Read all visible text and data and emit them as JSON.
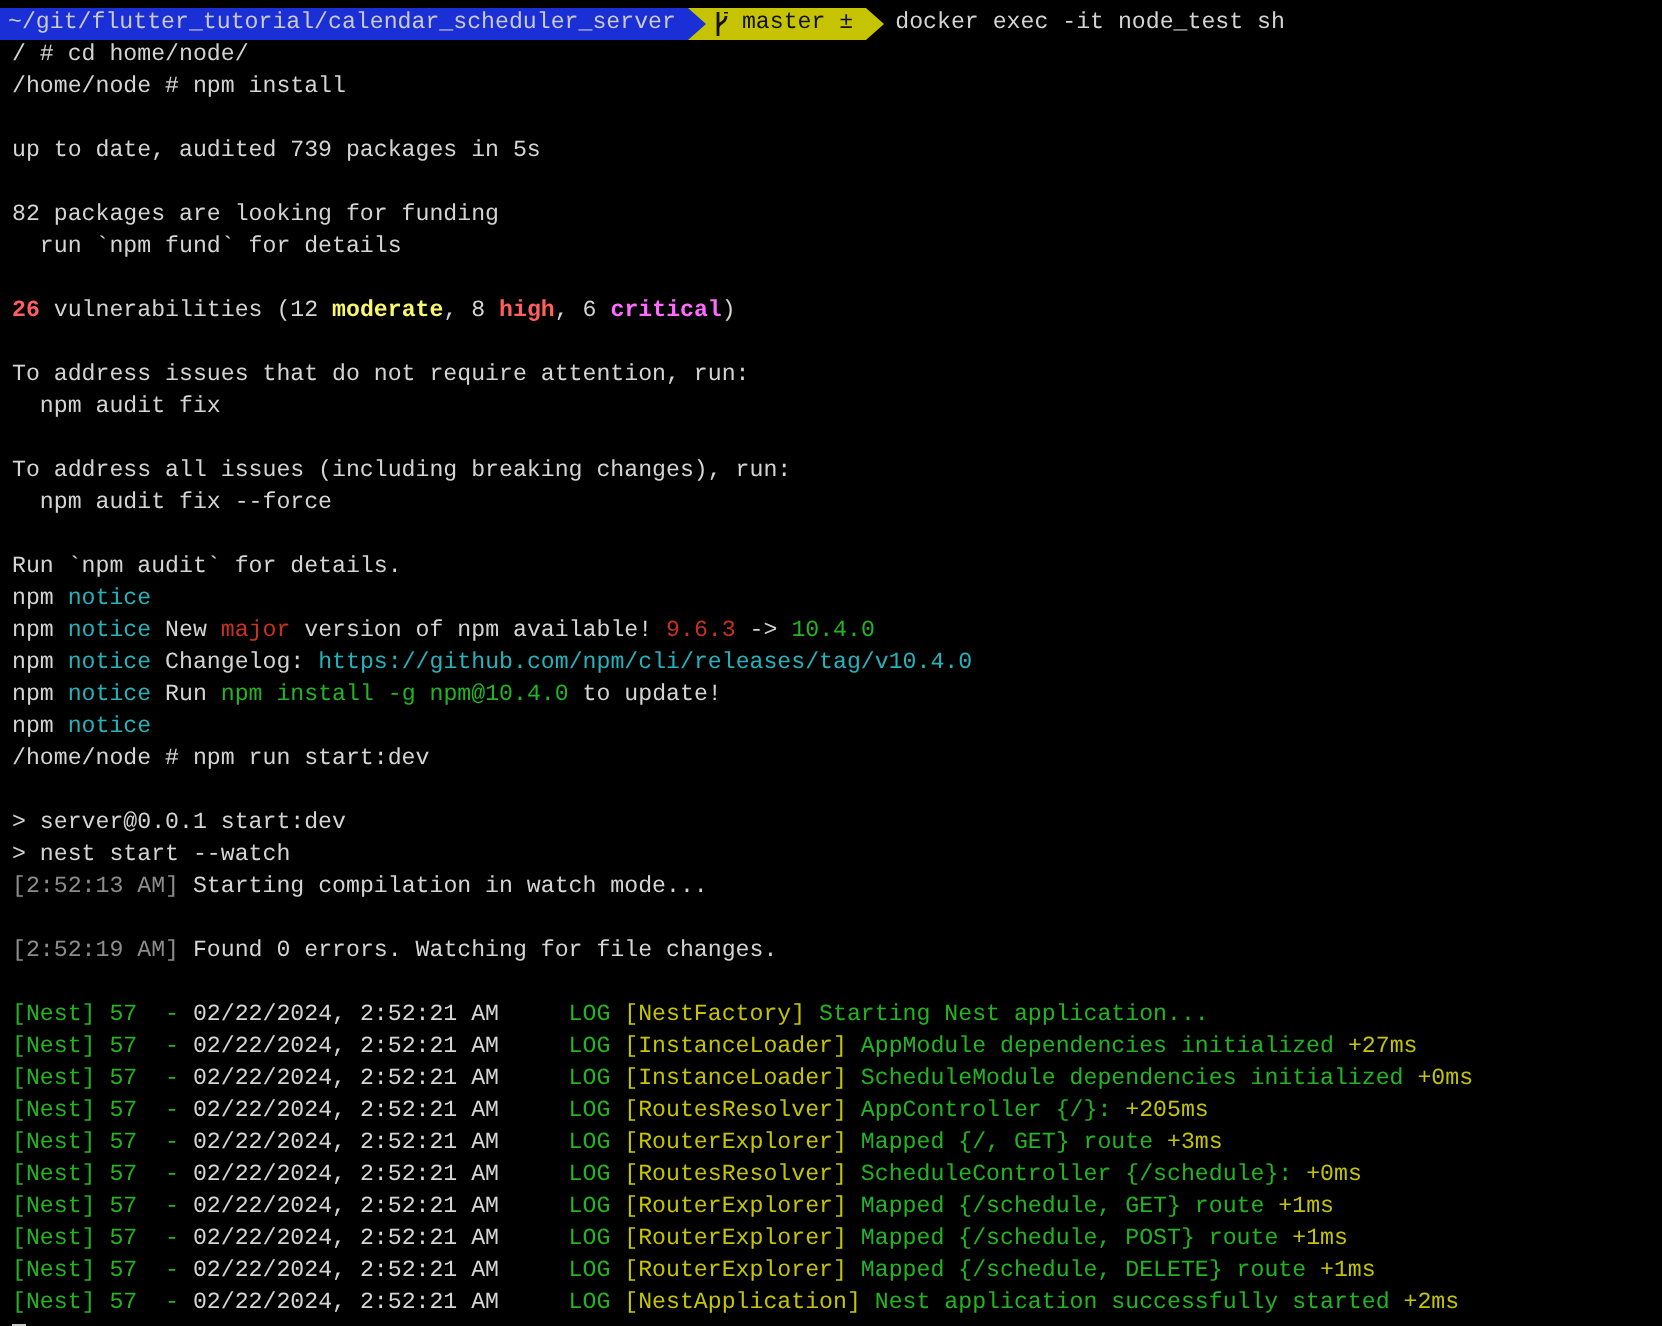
{
  "prompt": {
    "path": "~/git/flutter_tutorial/calendar_scheduler_server",
    "branch": "master ±",
    "command": "docker exec -it node_test sh"
  },
  "lines": [
    {
      "kind": "text",
      "segments": [
        {
          "text": "/ # cd home/node/",
          "kind": "plain"
        }
      ]
    },
    {
      "kind": "text",
      "segments": [
        {
          "text": "/home/node # npm install",
          "kind": "plain"
        }
      ]
    },
    {
      "kind": "blank"
    },
    {
      "kind": "text",
      "segments": [
        {
          "text": "up to date, audited 739 packages in 5s",
          "kind": "plain"
        }
      ]
    },
    {
      "kind": "blank"
    },
    {
      "kind": "text",
      "segments": [
        {
          "text": "82 packages are looking for funding",
          "kind": "plain"
        }
      ]
    },
    {
      "kind": "text",
      "segments": [
        {
          "text": "  run `npm fund` for details",
          "kind": "plain"
        }
      ]
    },
    {
      "kind": "blank"
    },
    {
      "kind": "text",
      "segments": [
        {
          "text": "26",
          "kind": "bold-red"
        },
        {
          "text": " vulnerabilities (12 ",
          "kind": "plain"
        },
        {
          "text": "moderate",
          "kind": "bold-yellow"
        },
        {
          "text": ", 8 ",
          "kind": "plain"
        },
        {
          "text": "high",
          "kind": "bold-red"
        },
        {
          "text": ", 6 ",
          "kind": "plain"
        },
        {
          "text": "critical",
          "kind": "bold-magenta"
        },
        {
          "text": ")",
          "kind": "plain"
        }
      ]
    },
    {
      "kind": "blank"
    },
    {
      "kind": "text",
      "segments": [
        {
          "text": "To address issues that do not require attention, run:",
          "kind": "plain"
        }
      ]
    },
    {
      "kind": "text",
      "segments": [
        {
          "text": "  npm audit fix",
          "kind": "plain"
        }
      ]
    },
    {
      "kind": "blank"
    },
    {
      "kind": "text",
      "segments": [
        {
          "text": "To address all issues (including breaking changes), run:",
          "kind": "plain"
        }
      ]
    },
    {
      "kind": "text",
      "segments": [
        {
          "text": "  npm audit fix --force",
          "kind": "plain"
        }
      ]
    },
    {
      "kind": "blank"
    },
    {
      "kind": "text",
      "segments": [
        {
          "text": "Run `npm audit` for details.",
          "kind": "plain"
        }
      ]
    },
    {
      "kind": "text",
      "segments": [
        {
          "text": "npm ",
          "kind": "plain"
        },
        {
          "text": "notice",
          "kind": "cyan"
        }
      ]
    },
    {
      "kind": "text",
      "segments": [
        {
          "text": "npm ",
          "kind": "plain"
        },
        {
          "text": "notice",
          "kind": "cyan"
        },
        {
          "text": " New ",
          "kind": "plain"
        },
        {
          "text": "major",
          "kind": "red"
        },
        {
          "text": " version of npm available! ",
          "kind": "plain"
        },
        {
          "text": "9.6.3",
          "kind": "red"
        },
        {
          "text": " -> ",
          "kind": "plain"
        },
        {
          "text": "10.4.0",
          "kind": "green"
        }
      ]
    },
    {
      "kind": "text",
      "segments": [
        {
          "text": "npm ",
          "kind": "plain"
        },
        {
          "text": "notice",
          "kind": "cyan"
        },
        {
          "text": " Changelog: ",
          "kind": "plain"
        },
        {
          "text": "https://github.com/npm/cli/releases/tag/v10.4.0",
          "kind": "cyan"
        }
      ]
    },
    {
      "kind": "text",
      "segments": [
        {
          "text": "npm ",
          "kind": "plain"
        },
        {
          "text": "notice",
          "kind": "cyan"
        },
        {
          "text": " Run ",
          "kind": "plain"
        },
        {
          "text": "npm install -g npm@10.4.0",
          "kind": "green"
        },
        {
          "text": " to update!",
          "kind": "plain"
        }
      ]
    },
    {
      "kind": "text",
      "segments": [
        {
          "text": "npm ",
          "kind": "plain"
        },
        {
          "text": "notice",
          "kind": "cyan"
        }
      ]
    },
    {
      "kind": "text",
      "segments": [
        {
          "text": "/home/node # npm run start:dev",
          "kind": "plain"
        }
      ]
    },
    {
      "kind": "blank"
    },
    {
      "kind": "text",
      "segments": [
        {
          "text": "> server@0.0.1 start:dev",
          "kind": "plain"
        }
      ]
    },
    {
      "kind": "text",
      "segments": [
        {
          "text": "> nest start --watch",
          "kind": "plain"
        }
      ]
    },
    {
      "kind": "text",
      "segments": [
        {
          "text": "[2:52:13 AM]",
          "kind": "gray"
        },
        {
          "text": " Starting compilation in watch mode...",
          "kind": "plain"
        }
      ]
    },
    {
      "kind": "blank"
    },
    {
      "kind": "text",
      "segments": [
        {
          "text": "[2:52:19 AM]",
          "kind": "gray"
        },
        {
          "text": " Found 0 errors. Watching for file changes.",
          "kind": "plain"
        }
      ]
    },
    {
      "kind": "blank"
    },
    {
      "kind": "text",
      "segments": [
        {
          "text": "[Nest] 57  - ",
          "kind": "green"
        },
        {
          "text": "02/22/2024, 2:52:21 AM",
          "kind": "plain"
        },
        {
          "text": "     LOG ",
          "kind": "green"
        },
        {
          "text": "[NestFactory]",
          "kind": "yellow"
        },
        {
          "text": " Starting Nest application...",
          "kind": "green"
        }
      ]
    },
    {
      "kind": "text",
      "segments": [
        {
          "text": "[Nest] 57  - ",
          "kind": "green"
        },
        {
          "text": "02/22/2024, 2:52:21 AM",
          "kind": "plain"
        },
        {
          "text": "     LOG ",
          "kind": "green"
        },
        {
          "text": "[InstanceLoader]",
          "kind": "yellow"
        },
        {
          "text": " AppModule dependencies initialized",
          "kind": "green"
        },
        {
          "text": " +27ms",
          "kind": "yellow"
        }
      ]
    },
    {
      "kind": "text",
      "segments": [
        {
          "text": "[Nest] 57  - ",
          "kind": "green"
        },
        {
          "text": "02/22/2024, 2:52:21 AM",
          "kind": "plain"
        },
        {
          "text": "     LOG ",
          "kind": "green"
        },
        {
          "text": "[InstanceLoader]",
          "kind": "yellow"
        },
        {
          "text": " ScheduleModule dependencies initialized",
          "kind": "green"
        },
        {
          "text": " +0ms",
          "kind": "yellow"
        }
      ]
    },
    {
      "kind": "text",
      "segments": [
        {
          "text": "[Nest] 57  - ",
          "kind": "green"
        },
        {
          "text": "02/22/2024, 2:52:21 AM",
          "kind": "plain"
        },
        {
          "text": "     LOG ",
          "kind": "green"
        },
        {
          "text": "[RoutesResolver]",
          "kind": "yellow"
        },
        {
          "text": " AppController {/}:",
          "kind": "green"
        },
        {
          "text": " +205ms",
          "kind": "yellow"
        }
      ]
    },
    {
      "kind": "text",
      "segments": [
        {
          "text": "[Nest] 57  - ",
          "kind": "green"
        },
        {
          "text": "02/22/2024, 2:52:21 AM",
          "kind": "plain"
        },
        {
          "text": "     LOG ",
          "kind": "green"
        },
        {
          "text": "[RouterExplorer]",
          "kind": "yellow"
        },
        {
          "text": " Mapped {/, GET} route",
          "kind": "green"
        },
        {
          "text": " +3ms",
          "kind": "yellow"
        }
      ]
    },
    {
      "kind": "text",
      "segments": [
        {
          "text": "[Nest] 57  - ",
          "kind": "green"
        },
        {
          "text": "02/22/2024, 2:52:21 AM",
          "kind": "plain"
        },
        {
          "text": "     LOG ",
          "kind": "green"
        },
        {
          "text": "[RoutesResolver]",
          "kind": "yellow"
        },
        {
          "text": " ScheduleController {/schedule}:",
          "kind": "green"
        },
        {
          "text": " +0ms",
          "kind": "yellow"
        }
      ]
    },
    {
      "kind": "text",
      "segments": [
        {
          "text": "[Nest] 57  - ",
          "kind": "green"
        },
        {
          "text": "02/22/2024, 2:52:21 AM",
          "kind": "plain"
        },
        {
          "text": "     LOG ",
          "kind": "green"
        },
        {
          "text": "[RouterExplorer]",
          "kind": "yellow"
        },
        {
          "text": " Mapped {/schedule, GET} route",
          "kind": "green"
        },
        {
          "text": " +1ms",
          "kind": "yellow"
        }
      ]
    },
    {
      "kind": "text",
      "segments": [
        {
          "text": "[Nest] 57  - ",
          "kind": "green"
        },
        {
          "text": "02/22/2024, 2:52:21 AM",
          "kind": "plain"
        },
        {
          "text": "     LOG ",
          "kind": "green"
        },
        {
          "text": "[RouterExplorer]",
          "kind": "yellow"
        },
        {
          "text": " Mapped {/schedule, POST} route",
          "kind": "green"
        },
        {
          "text": " +1ms",
          "kind": "yellow"
        }
      ]
    },
    {
      "kind": "text",
      "segments": [
        {
          "text": "[Nest] 57  - ",
          "kind": "green"
        },
        {
          "text": "02/22/2024, 2:52:21 AM",
          "kind": "plain"
        },
        {
          "text": "     LOG ",
          "kind": "green"
        },
        {
          "text": "[RouterExplorer]",
          "kind": "yellow"
        },
        {
          "text": " Mapped {/schedule, DELETE} route",
          "kind": "green"
        },
        {
          "text": " +1ms",
          "kind": "yellow"
        }
      ]
    },
    {
      "kind": "text",
      "segments": [
        {
          "text": "[Nest] 57  - ",
          "kind": "green"
        },
        {
          "text": "02/22/2024, 2:52:21 AM",
          "kind": "plain"
        },
        {
          "text": "     LOG ",
          "kind": "green"
        },
        {
          "text": "[NestApplication]",
          "kind": "yellow"
        },
        {
          "text": " Nest application successfully started",
          "kind": "green"
        },
        {
          "text": " +2ms",
          "kind": "yellow"
        }
      ]
    },
    {
      "kind": "cursor"
    }
  ]
}
